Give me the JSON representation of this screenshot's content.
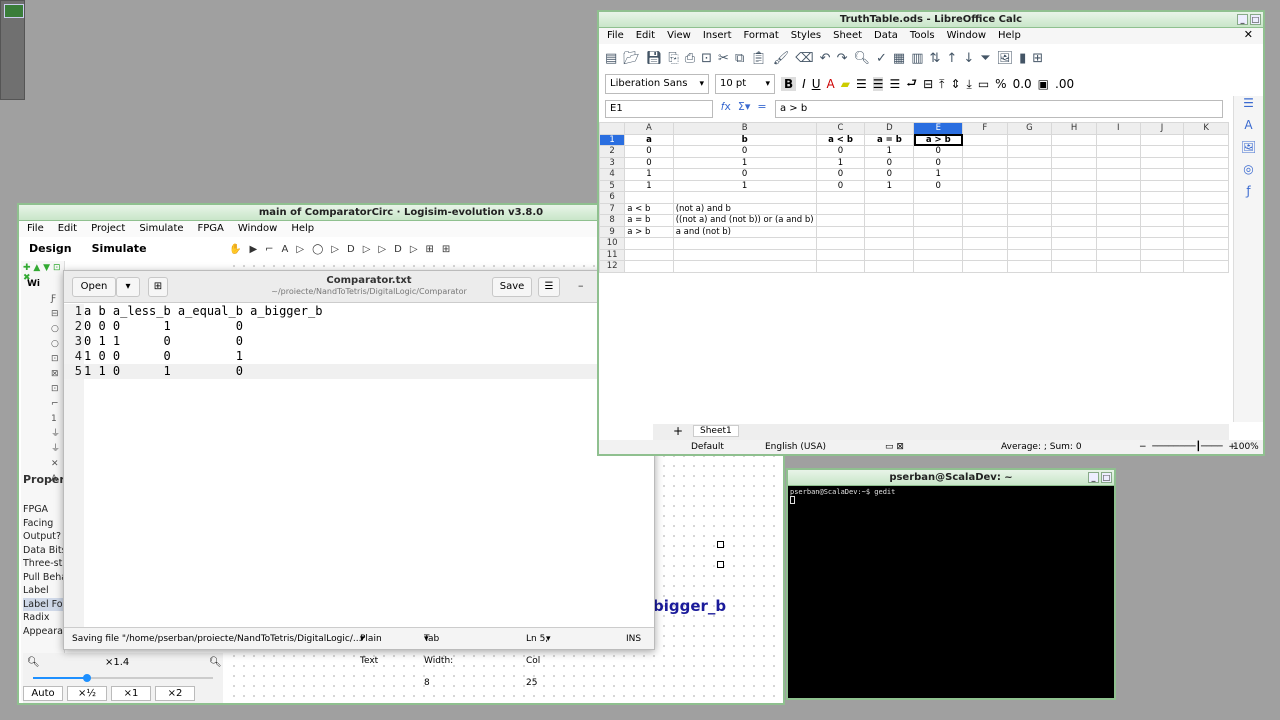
{
  "logisim": {
    "title": "main of ComparatorCirc · Logisim-evolution v3.8.0",
    "menu": [
      "File",
      "Edit",
      "Project",
      "Simulate",
      "FPGA",
      "Window",
      "Help"
    ],
    "tabs": [
      "Design",
      "Simulate"
    ],
    "tree_label": "Wi",
    "properties_header": "Proper",
    "properties": [
      "FPGA",
      "Facing",
      "Output?",
      "Data Bits",
      "Three-st",
      "Pull Beha",
      "Label",
      "Label Fo",
      "Radix",
      "Appeara"
    ],
    "selected_property": "Label Fo",
    "zoom_level": "×1.4",
    "zoom_slider_fraction": 0.3,
    "zoom_buttons": [
      "Auto",
      "×½",
      "×1",
      "×2"
    ],
    "canvas_label": "bigger_b"
  },
  "gedit": {
    "title": "Comparator.txt",
    "subtitle": "~/proiecte/NandToTetris/DigitalLogic/Comparator",
    "open_label": "Open",
    "save_label": "Save",
    "lines": [
      {
        "n": "1",
        "text": "a b a_less_b a_equal_b a_bigger_b"
      },
      {
        "n": "2",
        "text": "0 0 0      1         0"
      },
      {
        "n": "3",
        "text": "0 1 1      0         0"
      },
      {
        "n": "4",
        "text": "1 0 0      0         1"
      },
      {
        "n": "5",
        "text": "1 1 0      1         0"
      }
    ],
    "status": {
      "message": "Saving file \"/home/pserban/proiecte/NandToTetris/DigitalLogic/...",
      "syntax": "Plain Text",
      "tab_width": "Tab Width: 8",
      "position": "Ln 5, Col 25",
      "mode": "INS"
    }
  },
  "calc": {
    "title": "TruthTable.ods - LibreOffice Calc",
    "menu": [
      "File",
      "Edit",
      "View",
      "Insert",
      "Format",
      "Styles",
      "Sheet",
      "Data",
      "Tools",
      "Window",
      "Help"
    ],
    "font_name": "Liberation Sans",
    "font_size": "10 pt",
    "name_box": "E1",
    "formula": "a > b",
    "columns": [
      "A",
      "B",
      "C",
      "D",
      "E",
      "F",
      "G",
      "H",
      "I",
      "J",
      "K"
    ],
    "rows": [
      [
        "a",
        "b",
        "a < b",
        "a = b",
        "a > b",
        "",
        "",
        "",
        "",
        "",
        ""
      ],
      [
        "0",
        "0",
        "0",
        "1",
        "0",
        "",
        "",
        "",
        "",
        "",
        ""
      ],
      [
        "0",
        "1",
        "1",
        "0",
        "0",
        "",
        "",
        "",
        "",
        "",
        ""
      ],
      [
        "1",
        "0",
        "0",
        "0",
        "1",
        "",
        "",
        "",
        "",
        "",
        ""
      ],
      [
        "1",
        "1",
        "0",
        "1",
        "0",
        "",
        "",
        "",
        "",
        "",
        ""
      ],
      [
        "",
        "",
        "",
        "",
        "",
        "",
        "",
        "",
        "",
        "",
        ""
      ],
      [
        "a < b",
        "(not a) and b",
        "",
        "",
        "",
        "",
        "",
        "",
        "",
        "",
        ""
      ],
      [
        "a = b",
        "((not a) and (not b)) or (a and b)",
        "",
        "",
        "",
        "",
        "",
        "",
        "",
        "",
        ""
      ],
      [
        "a > b",
        "a and (not b)",
        "",
        "",
        "",
        "",
        "",
        "",
        "",
        "",
        ""
      ],
      [
        "",
        "",
        "",
        "",
        "",
        "",
        "",
        "",
        "",
        "",
        ""
      ],
      [
        "",
        "",
        "",
        "",
        "",
        "",
        "",
        "",
        "",
        "",
        ""
      ],
      [
        "",
        "",
        "",
        "",
        "",
        "",
        "",
        "",
        "",
        "",
        ""
      ]
    ],
    "sheet_tab": "Sheet1",
    "status": {
      "style": "Default",
      "language": "English (USA)",
      "summary": "Average: ; Sum: 0",
      "zoom": "100%"
    }
  },
  "terminal": {
    "title": "pserban@ScalaDev: ~",
    "prompt_line": "pserban@ScalaDev:~$ gedit"
  }
}
